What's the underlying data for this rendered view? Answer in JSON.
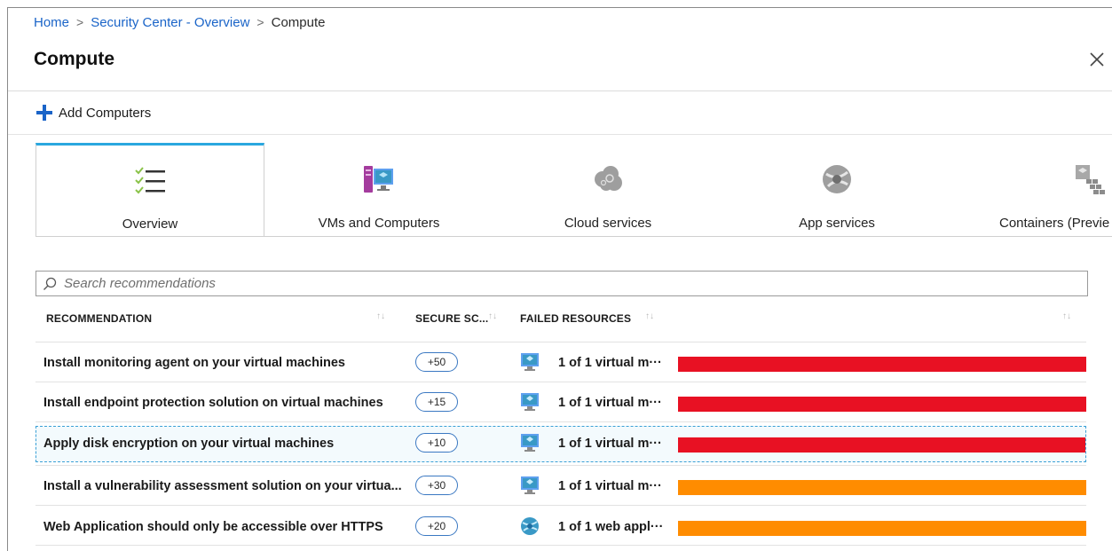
{
  "breadcrumb": {
    "home": "Home",
    "overview": "Security Center - Overview",
    "current": "Compute",
    "sep": ">"
  },
  "page_title": "Compute",
  "toolbar": {
    "add_label": "Add Computers"
  },
  "tabs": [
    {
      "label": "Overview",
      "icon": "checklist-icon",
      "active": true
    },
    {
      "label": "VMs and Computers",
      "icon": "vm-icon"
    },
    {
      "label": "Cloud services",
      "icon": "cloud-services-icon"
    },
    {
      "label": "App services",
      "icon": "app-services-icon"
    },
    {
      "label": "Containers (Previe",
      "icon": "containers-icon"
    }
  ],
  "search": {
    "placeholder": "Search recommendations"
  },
  "table": {
    "headers": {
      "recommendation": "RECOMMENDATION",
      "secure_score": "SECURE SC...",
      "failed_resources": "FAILED RESOURCES"
    },
    "rows": [
      {
        "recommendation": "Install monitoring agent on your virtual machines",
        "score": "+50",
        "failed": "1 of 1 virtual m···",
        "resource_icon": "vm-icon",
        "severity_color": "#e81123"
      },
      {
        "recommendation": "Install endpoint protection solution on virtual machines",
        "score": "+15",
        "failed": "1 of 1 virtual m···",
        "resource_icon": "vm-icon",
        "severity_color": "#e81123"
      },
      {
        "recommendation": "Apply disk encryption on your virtual machines",
        "score": "+10",
        "failed": "1 of 1 virtual m···",
        "resource_icon": "vm-icon",
        "severity_color": "#e81123",
        "selected": true
      },
      {
        "recommendation": "Install a vulnerability assessment solution on your virtua...",
        "score": "+30",
        "failed": "1 of 1 virtual m···",
        "resource_icon": "vm-icon",
        "severity_color": "#ff8c00"
      },
      {
        "recommendation": "Web Application should only be accessible over HTTPS",
        "score": "+20",
        "failed": "1 of 1 web appl···",
        "resource_icon": "web-app-icon",
        "severity_color": "#ff8c00"
      }
    ]
  },
  "colors": {
    "accent": "#1a64c8",
    "tab_active": "#2aa7df",
    "high": "#e81123",
    "medium": "#ff8c00"
  }
}
